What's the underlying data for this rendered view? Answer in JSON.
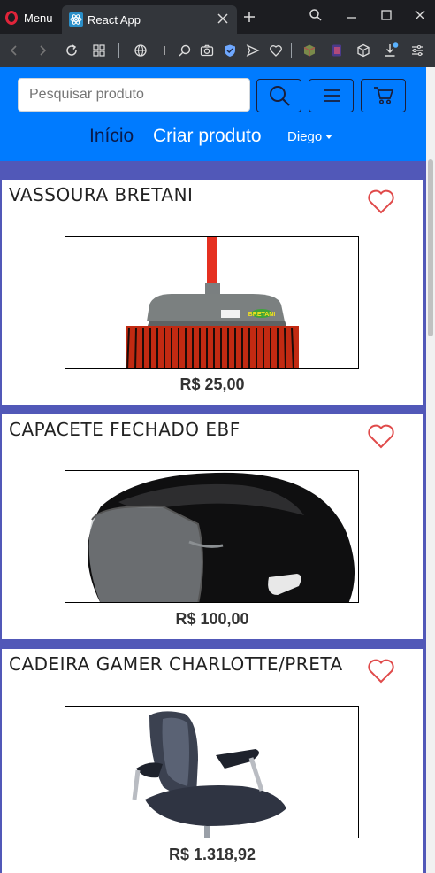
{
  "browser": {
    "menu_label": "Menu",
    "tab_title": "React App"
  },
  "navbar": {
    "search_placeholder": "Pesquisar produto",
    "links": {
      "home": "Início",
      "create": "Criar produto"
    },
    "user_name": "Diego"
  },
  "products": [
    {
      "name": "VASSOURA BRETANI",
      "price": "R$ 25,00",
      "brand_label": "BRETANI"
    },
    {
      "name": "CAPACETE FECHADO EBF",
      "price": "R$ 100,00"
    },
    {
      "name": "CADEIRA GAMER CHARLOTTE/PRETA",
      "price": "R$ 1.318,92"
    }
  ],
  "colors": {
    "navbar": "#007bff",
    "page_background": "#5158b8",
    "heart": "#e04a4a"
  }
}
